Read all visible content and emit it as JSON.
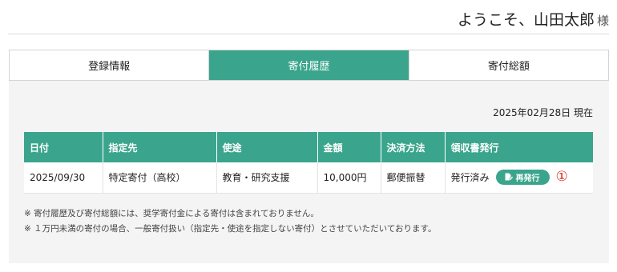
{
  "header": {
    "greeting": "ようこそ、山田太郎",
    "honorific": "様"
  },
  "tabs": [
    {
      "label": "登録情報",
      "active": false
    },
    {
      "label": "寄付履歴",
      "active": true
    },
    {
      "label": "寄付総額",
      "active": false
    }
  ],
  "history": {
    "as_of": "2025年02月28日 現在",
    "columns": [
      "日付",
      "指定先",
      "使途",
      "金額",
      "決済方法",
      "領収書発行"
    ],
    "rows": [
      {
        "date": "2025/09/30",
        "designation": "特定寄付（高校）",
        "purpose": "教育・研究支援",
        "amount": "10,000円",
        "payment_method": "郵便振替",
        "receipt_status": "発行済み",
        "reissue_label": "再発行",
        "marker": "①"
      }
    ],
    "notes": [
      "※ 寄付履歴及び寄付総額には、奨学寄付金による寄付は含まれておりません。",
      "※ １万円未満の寄付の場合、一般寄付扱い（指定先・使途を指定しない寄付）とさせていただいております。"
    ]
  },
  "colors": {
    "accent": "#3aa58c",
    "marker": "#e0281e",
    "panel_background": "#f4f4f4"
  },
  "icons": {
    "reissue": "document-edit-icon"
  }
}
